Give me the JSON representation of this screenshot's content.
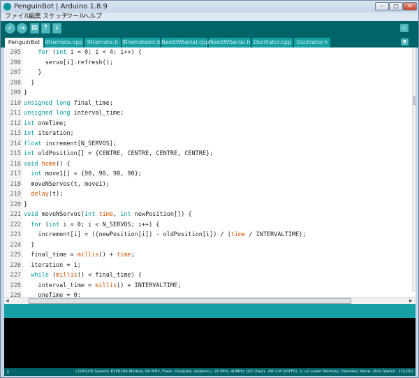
{
  "window": {
    "title": "PenguinBot | Arduino 1.8.9",
    "controls": {
      "minimize": "–",
      "maximize": "□",
      "close": "✕"
    }
  },
  "menu": [
    "ファイル",
    "編集",
    "スケッチ",
    "ツール",
    "ヘルプ"
  ],
  "toolbar": {
    "verify_icon": "check-icon",
    "upload_icon": "arrow-right-icon",
    "new_icon": "new-file-icon",
    "open_icon": "arrow-up-icon",
    "save_icon": "arrow-down-icon",
    "serial_monitor_icon": "magnifier-icon",
    "glyphs": {
      "verify": "✓",
      "upload": "→",
      "new": "▤",
      "open": "↑",
      "save": "↓",
      "serial": "⌕",
      "tabs_menu": "▼"
    }
  },
  "tabs": [
    "PenguinBot",
    "IRremote.cpp",
    "IRremote.h",
    "IRremoteInt.h",
    "NeoSWSerial.cpp",
    "NeoSWSerial.h",
    "Oscillator.cpp",
    "Oscillator.h"
  ],
  "editor": {
    "lines": [
      {
        "n": "205",
        "code": [
          {
            "t": "    "
          },
          {
            "t": "for",
            "k": "kw"
          },
          {
            "t": " ("
          },
          {
            "t": "int",
            "k": "kw"
          },
          {
            "t": " i = 0; i < 4; i++) {"
          }
        ]
      },
      {
        "n": "206",
        "code": [
          {
            "t": "      servo[i].refresh();"
          }
        ]
      },
      {
        "n": "207",
        "code": [
          {
            "t": "    }"
          }
        ]
      },
      {
        "n": "208",
        "code": [
          {
            "t": "  }"
          }
        ]
      },
      {
        "n": "209",
        "code": [
          {
            "t": "}"
          }
        ]
      },
      {
        "n": "210",
        "code": [
          {
            "t": "unsigned",
            "k": "kw"
          },
          {
            "t": " "
          },
          {
            "t": "long",
            "k": "kw"
          },
          {
            "t": " final_time;"
          }
        ]
      },
      {
        "n": "211",
        "code": [
          {
            "t": "unsigned",
            "k": "kw"
          },
          {
            "t": " "
          },
          {
            "t": "long",
            "k": "kw"
          },
          {
            "t": " interval_time;"
          }
        ]
      },
      {
        "n": "212",
        "code": [
          {
            "t": "int",
            "k": "kw"
          },
          {
            "t": " oneTime;"
          }
        ]
      },
      {
        "n": "213",
        "code": [
          {
            "t": "int",
            "k": "kw"
          },
          {
            "t": " iteration;"
          }
        ]
      },
      {
        "n": "214",
        "code": [
          {
            "t": "float",
            "k": "kw"
          },
          {
            "t": " increment[N_SERVOS];"
          }
        ]
      },
      {
        "n": "215",
        "code": [
          {
            "t": "int",
            "k": "kw"
          },
          {
            "t": " oldPosition[] = {CENTRE, CENTRE, CENTRE, CENTRE};"
          }
        ]
      },
      {
        "n": "216",
        "code": [
          {
            "t": "void",
            "k": "kw"
          },
          {
            "t": " "
          },
          {
            "t": "home",
            "k": "fn"
          },
          {
            "t": "() {"
          }
        ]
      },
      {
        "n": "217",
        "code": [
          {
            "t": "  "
          },
          {
            "t": "int",
            "k": "kw"
          },
          {
            "t": " move1[] = {90, 90, 90, 90};"
          }
        ]
      },
      {
        "n": "218",
        "code": [
          {
            "t": "  moveNServos(t, move1);"
          }
        ]
      },
      {
        "n": "219",
        "code": [
          {
            "t": "  "
          },
          {
            "t": "delay",
            "k": "fn"
          },
          {
            "t": "(t);"
          }
        ]
      },
      {
        "n": "220",
        "code": [
          {
            "t": "}"
          }
        ]
      },
      {
        "n": "221",
        "code": [
          {
            "t": "void",
            "k": "kw"
          },
          {
            "t": " moveNServos("
          },
          {
            "t": "int",
            "k": "kw"
          },
          {
            "t": " "
          },
          {
            "t": "time",
            "k": "fn"
          },
          {
            "t": ", "
          },
          {
            "t": "int",
            "k": "kw"
          },
          {
            "t": " newPosition[]) {"
          }
        ]
      },
      {
        "n": "222",
        "code": [
          {
            "t": "  "
          },
          {
            "t": "for",
            "k": "kw"
          },
          {
            "t": " ("
          },
          {
            "t": "int",
            "k": "kw"
          },
          {
            "t": " i = 0; i < N_SERVOS; i++) {"
          }
        ]
      },
      {
        "n": "223",
        "code": [
          {
            "t": "    increment[i] = ((newPosition[i]) - oldPosition[i]) / ("
          },
          {
            "t": "time",
            "k": "fn"
          },
          {
            "t": " / INTERVALTIME);"
          }
        ]
      },
      {
        "n": "224",
        "code": [
          {
            "t": "  }"
          }
        ]
      },
      {
        "n": "225",
        "code": [
          {
            "t": "  final_time = "
          },
          {
            "t": "millis",
            "k": "fn"
          },
          {
            "t": "() + "
          },
          {
            "t": "time",
            "k": "fn"
          },
          {
            "t": ";"
          }
        ]
      },
      {
        "n": "226",
        "code": [
          {
            "t": "  iteration = 1;"
          }
        ]
      },
      {
        "n": "227",
        "code": [
          {
            "t": "  "
          },
          {
            "t": "while",
            "k": "kw"
          },
          {
            "t": " ("
          },
          {
            "t": "millis",
            "k": "fn"
          },
          {
            "t": "() < final_time) {"
          }
        ]
      },
      {
        "n": "228",
        "code": [
          {
            "t": "    interval_time = "
          },
          {
            "t": "millis",
            "k": "fn"
          },
          {
            "t": "() + INTERVALTIME;"
          }
        ]
      },
      {
        "n": "229",
        "code": [
          {
            "t": "    oneTime = 0;"
          }
        ]
      }
    ]
  },
  "status": {
    "line": "1",
    "board": "COM12の Generic ESP8266 Module, 80 MHz, Flash, Disabled, nodemcu, 26 MHz, 40MHz, QIO (fast), 2M (1M SPIFFS), 2, v2 Lower Memory, Disabled, None, Only Sketch, 115200"
  },
  "colors": {
    "accent": "#006468",
    "tab": "#17a1a5",
    "keyword": "#00979c",
    "function": "#d35400"
  }
}
